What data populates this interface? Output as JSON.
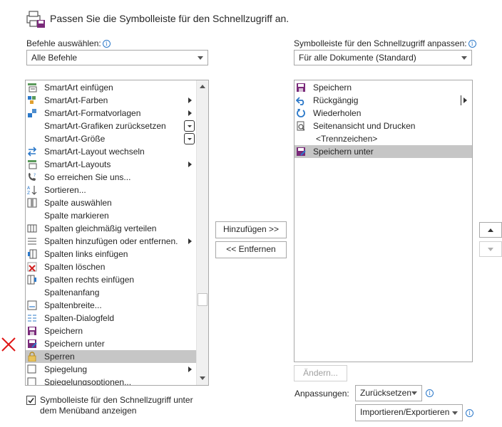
{
  "header": {
    "title": "Passen Sie die Symbolleiste für den Schnellzugriff an."
  },
  "left": {
    "label": "Befehle auswählen:",
    "dropdown_value": "Alle Befehle",
    "items": [
      {
        "label": "SmartArt einfügen",
        "icon": "smartart-insert-icon"
      },
      {
        "label": "SmartArt-Farben",
        "icon": "smartart-colors-icon",
        "submenu": true
      },
      {
        "label": "SmartArt-Formatvorlagen",
        "icon": "smartart-styles-icon",
        "submenu": true
      },
      {
        "label": "SmartArt-Grafiken zurücksetzen",
        "icon": "",
        "dropdown": true
      },
      {
        "label": "SmartArt-Größe",
        "icon": "",
        "dropdown": true
      },
      {
        "label": "SmartArt-Layout wechseln",
        "icon": "swap-arrows-icon"
      },
      {
        "label": "SmartArt-Layouts",
        "icon": "smartart-layouts-icon",
        "submenu": true
      },
      {
        "label": "So erreichen Sie uns...",
        "icon": "phone-help-icon"
      },
      {
        "label": "Sortieren...",
        "icon": "sort-az-icon"
      },
      {
        "label": "Spalte auswählen",
        "icon": "select-column-icon"
      },
      {
        "label": "Spalte markieren",
        "icon": ""
      },
      {
        "label": "Spalten gleichmäßig verteilen",
        "icon": "distribute-columns-icon"
      },
      {
        "label": "Spalten hinzufügen oder entfernen.",
        "icon": "add-remove-columns-icon",
        "submenu": true
      },
      {
        "label": "Spalten links einfügen",
        "icon": "insert-columns-left-icon"
      },
      {
        "label": "Spalten löschen",
        "icon": "delete-columns-icon"
      },
      {
        "label": "Spalten rechts einfügen",
        "icon": "insert-columns-right-icon"
      },
      {
        "label": "Spaltenanfang",
        "icon": ""
      },
      {
        "label": "Spaltenbreite...",
        "icon": "column-width-icon"
      },
      {
        "label": "Spalten-Dialogfeld",
        "icon": "columns-dialog-icon"
      },
      {
        "label": "Speichern",
        "icon": "save-icon"
      },
      {
        "label": "Speichern unter",
        "icon": "save-as-icon"
      },
      {
        "label": "Sperren",
        "icon": "lock-icon",
        "selected": true
      },
      {
        "label": "Spiegelung",
        "icon": "mirror-icon",
        "submenu": true
      },
      {
        "label": "Spiegelungsoptionen...",
        "icon": "mirror-options-icon"
      }
    ]
  },
  "right": {
    "label": "Symbolleiste für den Schnellzugriff anpassen:",
    "dropdown_value": "Für alle Dokumente (Standard)",
    "items": [
      {
        "label": "Speichern",
        "icon": "save-icon"
      },
      {
        "label": "Rückgängig",
        "icon": "undo-icon",
        "splitter": true
      },
      {
        "label": "Wiederholen",
        "icon": "redo-icon"
      },
      {
        "label": "Seitenansicht und Drucken",
        "icon": "print-preview-icon"
      },
      {
        "label": "<Trennzeichen>",
        "icon": ""
      },
      {
        "label": "Speichern unter",
        "icon": "save-as-icon",
        "selected": true
      }
    ]
  },
  "buttons": {
    "add": "Hinzufügen >>",
    "remove": "<< Entfernen",
    "modify": "Ändern...",
    "reset": "Zurücksetzen",
    "import_export": "Importieren/Exportieren"
  },
  "customizations_label": "Anpassungen:",
  "checkbox": {
    "line1": "Symbolleiste für den Schnellzugriff unter",
    "line2": "dem Menüband anzeigen",
    "checked": true
  },
  "colors": {
    "accent": "#2b78c9",
    "save_purple": "#7a2a7a",
    "selection": "#c6c6c6",
    "annotation_red": "#e01818"
  }
}
